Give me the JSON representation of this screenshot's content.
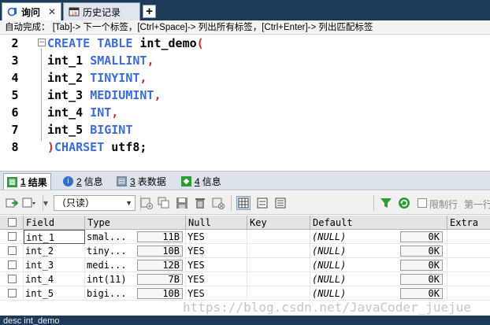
{
  "tabs": [
    {
      "label": "询问",
      "icon": "query-icon",
      "active": true
    },
    {
      "label": "历史记录",
      "icon": "history-icon",
      "active": false
    }
  ],
  "hint": "自动完成：  [Tab]-> 下一个标签，[Ctrl+Space]-> 列出所有标签，[Ctrl+Enter]-> 列出匹配标签",
  "editor": {
    "lines": [
      {
        "num": "2",
        "parts": [
          {
            "t": "CREATE TABLE ",
            "c": "kw"
          },
          {
            "t": "int_demo",
            "c": "id"
          },
          {
            "t": "(",
            "c": "paren"
          }
        ]
      },
      {
        "num": "3",
        "parts": [
          {
            "t": "int_1 ",
            "c": "id"
          },
          {
            "t": "SMALLINT",
            "c": "kw"
          },
          {
            "t": ",",
            "c": "paren"
          }
        ]
      },
      {
        "num": "4",
        "parts": [
          {
            "t": "int_2 ",
            "c": "id"
          },
          {
            "t": "TINYINT",
            "c": "kw"
          },
          {
            "t": ",",
            "c": "paren"
          }
        ]
      },
      {
        "num": "5",
        "parts": [
          {
            "t": "int_3 ",
            "c": "id"
          },
          {
            "t": "MEDIUMINT",
            "c": "kw"
          },
          {
            "t": ",",
            "c": "paren"
          }
        ]
      },
      {
        "num": "6",
        "parts": [
          {
            "t": "int_4 ",
            "c": "id"
          },
          {
            "t": "INT",
            "c": "kw"
          },
          {
            "t": ",",
            "c": "paren"
          }
        ]
      },
      {
        "num": "7",
        "parts": [
          {
            "t": "int_5 ",
            "c": "id"
          },
          {
            "t": "BIGINT",
            "c": "kw"
          }
        ]
      },
      {
        "num": "8",
        "parts": [
          {
            "t": ")",
            "c": "paren"
          },
          {
            "t": "CHARSET ",
            "c": "kw"
          },
          {
            "t": "utf8",
            "c": "id"
          },
          {
            "t": ";",
            "c": "id"
          }
        ]
      }
    ]
  },
  "result_tabs": [
    {
      "num": "1",
      "label": "结果",
      "icon": "result-grid-icon",
      "color": "#2f9a3a",
      "active": true
    },
    {
      "num": "2",
      "label": "信息",
      "icon": "info-icon",
      "color": "#2f6fd0",
      "active": false
    },
    {
      "num": "3",
      "label": "表数据",
      "icon": "table-data-icon",
      "color": "#7a8a9a",
      "active": false
    },
    {
      "num": "4",
      "label": "信息",
      "icon": "info-detail-icon",
      "color": "#2f9a3a",
      "active": false
    }
  ],
  "toolbar": {
    "mode": "（只读）",
    "limit_label": "限制行",
    "first_label": "第一行"
  },
  "grid": {
    "columns": [
      "Field",
      "Type",
      "Null",
      "Key",
      "Default",
      "Extra"
    ],
    "rows": [
      {
        "field": "int_1",
        "type": "smal...",
        "len": "11B",
        "null": "YES",
        "key": "",
        "default": "(NULL)",
        "def_len": "0K",
        "extra": ""
      },
      {
        "field": "int_2",
        "type": "tiny...",
        "len": "10B",
        "null": "YES",
        "key": "",
        "default": "(NULL)",
        "def_len": "0K",
        "extra": ""
      },
      {
        "field": "int_3",
        "type": "medi...",
        "len": "12B",
        "null": "YES",
        "key": "",
        "default": "(NULL)",
        "def_len": "0K",
        "extra": ""
      },
      {
        "field": "int_4",
        "type": "int(11)",
        "len": "7B",
        "null": "YES",
        "key": "",
        "default": "(NULL)",
        "def_len": "0K",
        "extra": ""
      },
      {
        "field": "int_5",
        "type": "bigi...",
        "len": "10B",
        "null": "YES",
        "key": "",
        "default": "(NULL)",
        "def_len": "0K",
        "extra": ""
      }
    ]
  },
  "watermark": "https://blog.csdn.net/JavaCoder_juejue",
  "status": "desc int_demo"
}
